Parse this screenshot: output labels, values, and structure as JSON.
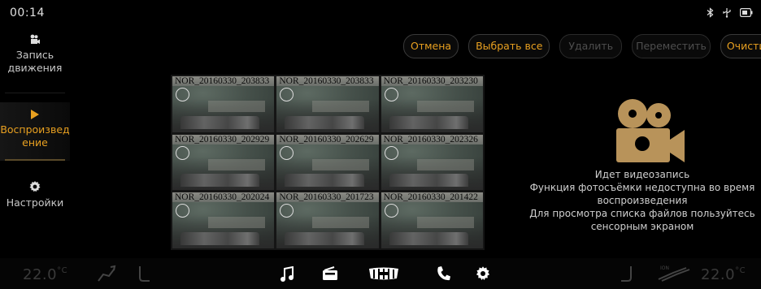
{
  "status": {
    "time": "00:14",
    "icons": [
      "bluetooth-icon",
      "usb-icon",
      "battery-icon"
    ]
  },
  "sidebar": {
    "items": [
      {
        "label": "Запись движения",
        "icon": "video-camera-icon",
        "active": false
      },
      {
        "label": "Воспроизведение",
        "icon": "play-icon",
        "active": true
      },
      {
        "label": "Настройки",
        "icon": "gear-icon",
        "active": false
      }
    ]
  },
  "toolbar": {
    "cancel": "Отмена",
    "select_all": "Выбрать все",
    "delete": "Удалить",
    "move": "Переместить",
    "clear": "Очистить"
  },
  "files": [
    "NOR_20160330_203833",
    "NOR_20160330_203833",
    "NOR_20160330_203230",
    "NOR_20160330_202929",
    "NOR_20160330_202629",
    "NOR_20160330_202326",
    "NOR_20160330_202024",
    "NOR_20160330_201723",
    "NOR_20160330_201422"
  ],
  "info": {
    "line1": "Идет видеозапись",
    "line2": "Функция фотосъёмки недоступна во время воспроизведения",
    "line3": "Для просмотра списка файлов пользуйтесь сенсорным экраном"
  },
  "bottom": {
    "temp_left": "22.0",
    "temp_right": "22.0",
    "unit": "°C",
    "icons": [
      "seat-recline-icon",
      "seat-heat-icon",
      "music-icon",
      "radio-icon",
      "car-grille-icon",
      "phone-icon",
      "settings-icon",
      "seat-right-icon",
      "climate-ion-icon"
    ]
  },
  "colors": {
    "accent": "#e8a020",
    "camera_big": "#b8935a"
  }
}
